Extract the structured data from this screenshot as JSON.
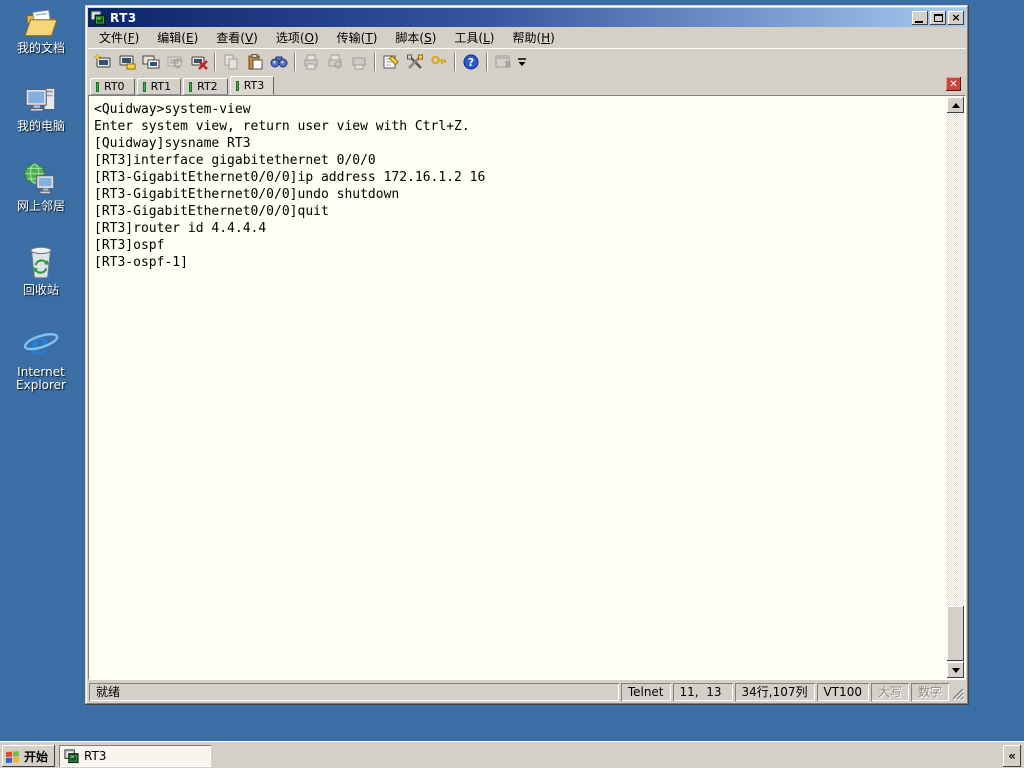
{
  "colors": {
    "desktop_bg": "#3A6EA5",
    "chrome": "#D4D0C8",
    "titlebar_from": "#0A246A",
    "titlebar_to": "#A6CAF0",
    "terminal_bg": "#FFFEF2",
    "tab_connected_green": "#3FAE49",
    "tab_close_red": "#C8463A"
  },
  "desktop": {
    "icons": [
      {
        "name": "my-documents",
        "label": "我的文档"
      },
      {
        "name": "my-computer",
        "label": "我的电脑"
      },
      {
        "name": "network-places",
        "label": "网上邻居"
      },
      {
        "name": "recycle-bin",
        "label": "回收站"
      },
      {
        "name": "internet-explorer",
        "label": "Internet Explorer"
      }
    ]
  },
  "window": {
    "title": "RT3",
    "menu": [
      {
        "pre": "文件(",
        "key": "F",
        "post": ")"
      },
      {
        "pre": "编辑(",
        "key": "E",
        "post": ")"
      },
      {
        "pre": "查看(",
        "key": "V",
        "post": ")"
      },
      {
        "pre": "选项(",
        "key": "O",
        "post": ")"
      },
      {
        "pre": "传输(",
        "key": "T",
        "post": ")"
      },
      {
        "pre": "脚本(",
        "key": "S",
        "post": ")"
      },
      {
        "pre": "工具(",
        "key": "L",
        "post": ")"
      },
      {
        "pre": "帮助(",
        "key": "H",
        "post": ")"
      }
    ],
    "toolbar_icons": [
      "quick-connect",
      "connect",
      "connect-in-tab",
      "reconnect",
      "disconnect",
      "copy",
      "paste",
      "find",
      "print",
      "print-preview",
      "print-setup",
      "session-options",
      "global-options",
      "key-agent",
      "help",
      "securefx",
      "toolbar-overflow"
    ]
  },
  "tabs": {
    "items": [
      {
        "label": "RT0"
      },
      {
        "label": "RT1"
      },
      {
        "label": "RT2"
      },
      {
        "label": "RT3"
      }
    ]
  },
  "terminal": {
    "lines": [
      "<Quidway>system-view",
      "Enter system view, return user view with Ctrl+Z.",
      "[Quidway]sysname RT3",
      "[RT3]interface gigabitethernet 0/0/0",
      "[RT3-GigabitEthernet0/0/0]ip address 172.16.1.2 16",
      "[RT3-GigabitEthernet0/0/0]undo shutdown",
      "[RT3-GigabitEthernet0/0/0]quit",
      "[RT3]router id 4.4.4.4",
      "[RT3]ospf",
      "[RT3-ospf-1]"
    ]
  },
  "statusbar": {
    "ready": "就绪",
    "protocol": "Telnet",
    "cursor_pos": "11,  13",
    "screen_size": "34行,107列",
    "emulation": "VT100",
    "caps": "大写",
    "num": "数字"
  },
  "taskbar": {
    "start_label": "开始",
    "task_label": "RT3",
    "overflow_label": "«"
  }
}
